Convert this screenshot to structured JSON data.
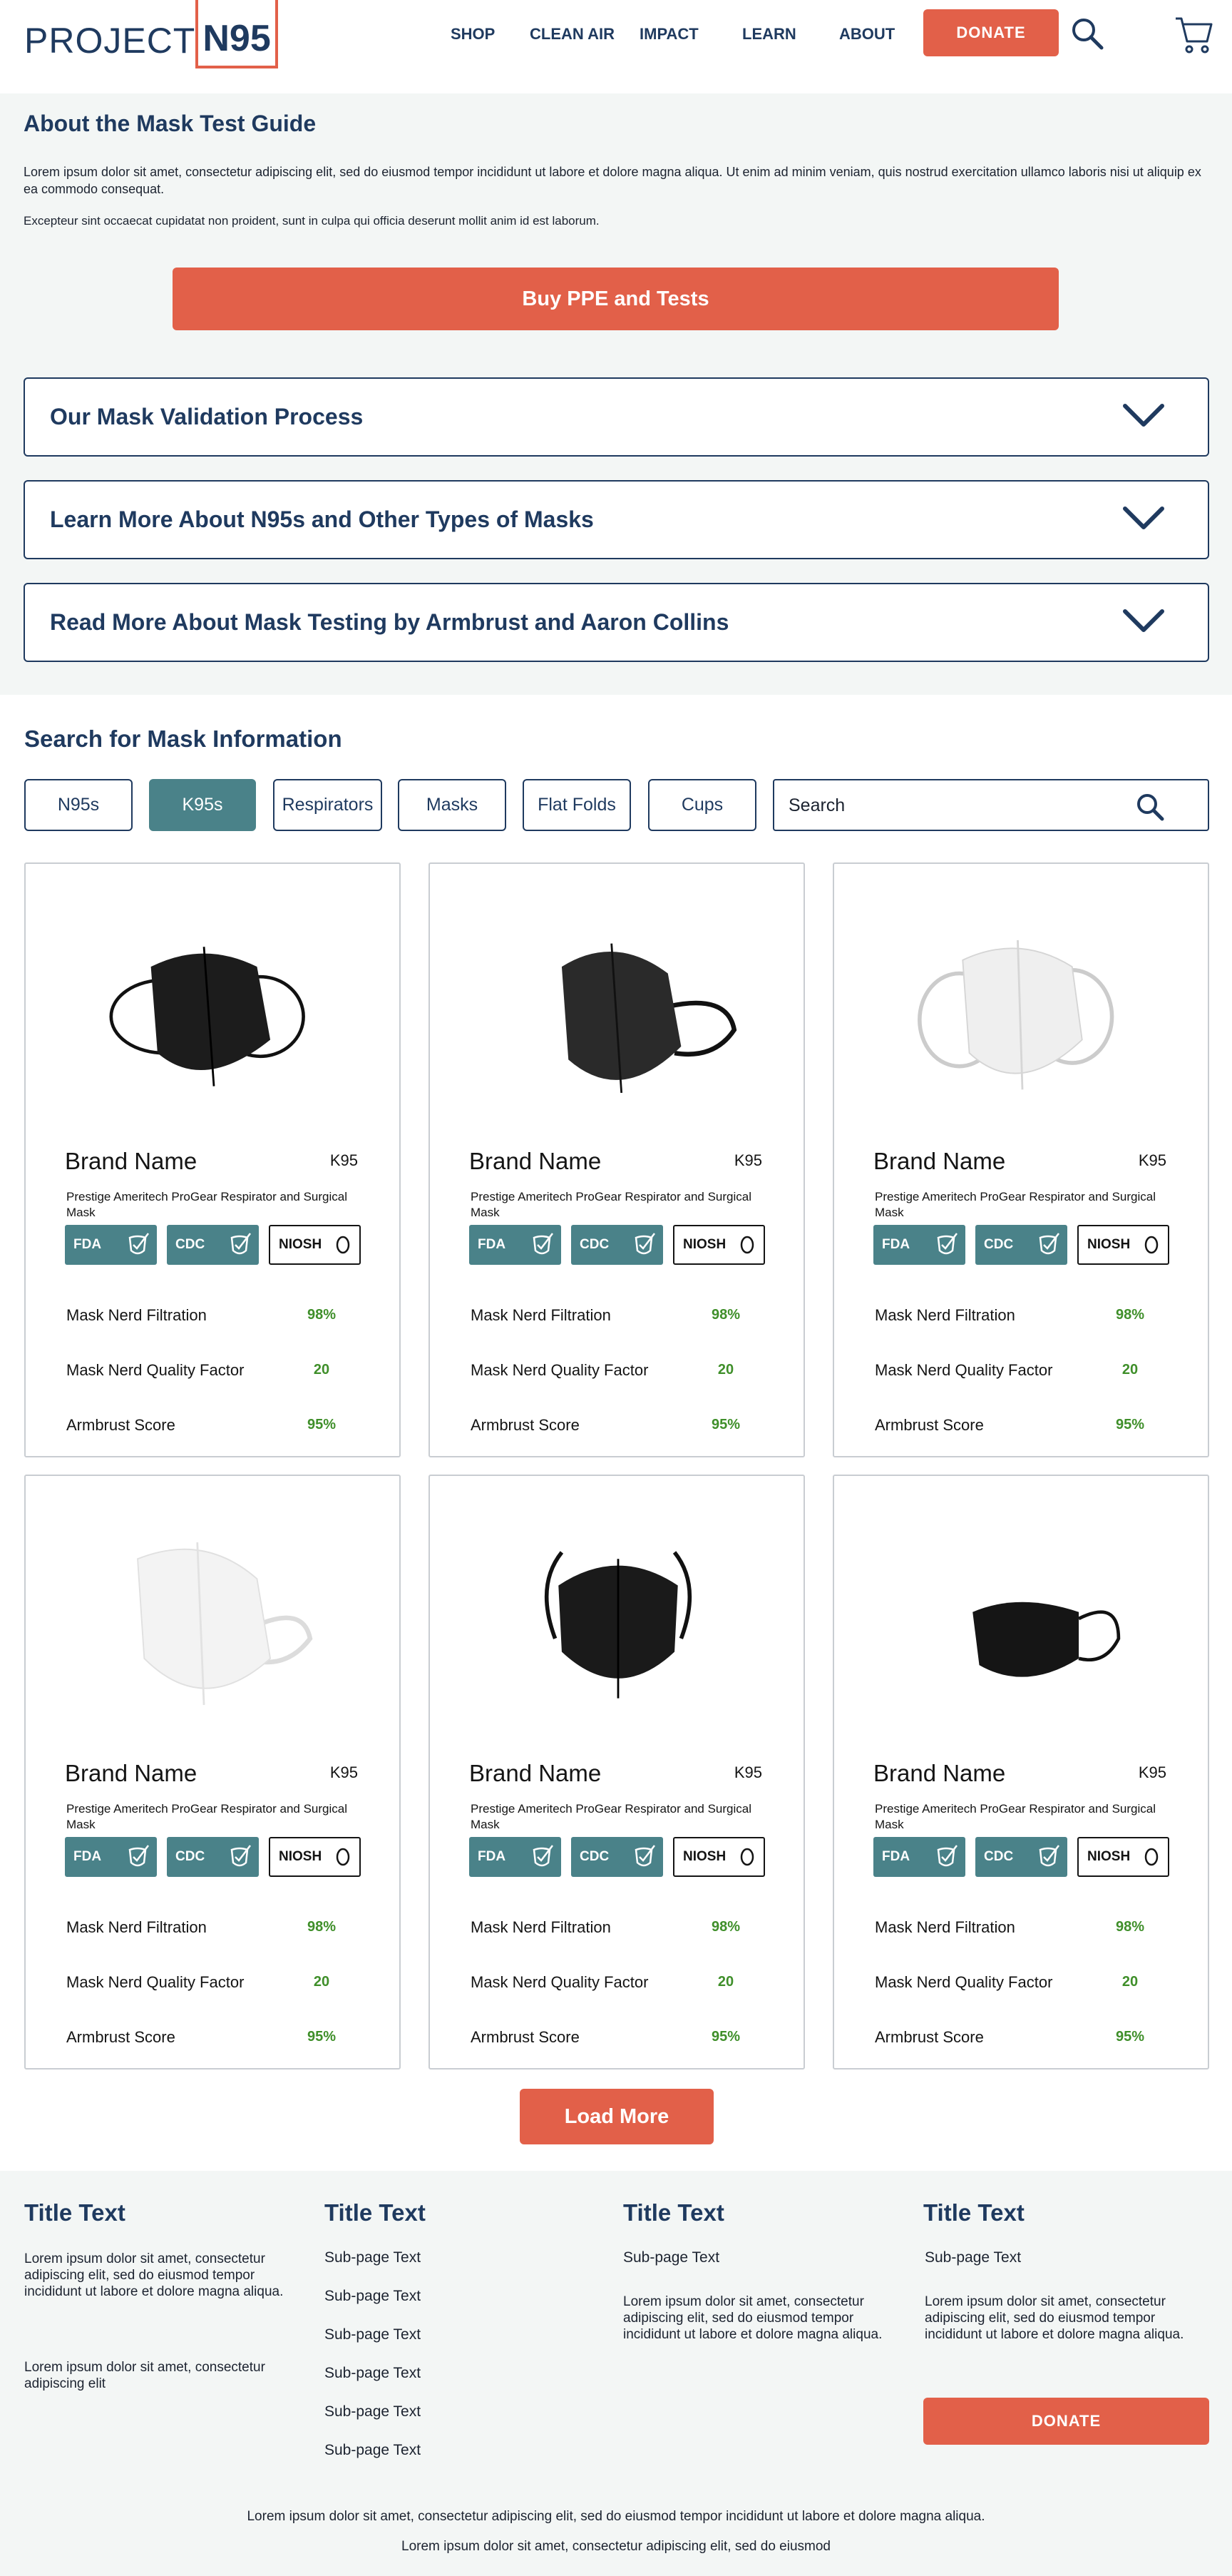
{
  "colors": {
    "primary": "#1f3a5f",
    "accent": "#e26049",
    "teal": "#4a8289",
    "score_green": "#3f8f2a",
    "section_bg": "#f3f6f5"
  },
  "header": {
    "logo_project": "PROJECT",
    "logo_n95": "N95",
    "nav": [
      "SHOP",
      "CLEAN AIR",
      "IMPACT",
      "LEARN",
      "ABOUT"
    ],
    "donate": "DONATE",
    "search_icon": "search-icon",
    "cart_icon": "cart-icon"
  },
  "about": {
    "title": "About the Mask Test Guide",
    "paragraph1": "Lorem ipsum dolor sit amet, consectetur adipiscing elit, sed do eiusmod tempor incididunt ut labore et dolore magna aliqua. Ut enim ad minim veniam, quis nostrud exercitation ullamco laboris nisi ut aliquip ex ea commodo consequat.",
    "paragraph2": "Excepteur sint occaecat cupidatat non proident, sunt in culpa qui officia deserunt mollit anim id est laborum.",
    "buy_button": "Buy PPE and Tests",
    "accordions": [
      "Our Mask Validation Process",
      "Learn More About N95s and Other Types of Masks",
      "Read More About Mask Testing by Armbrust and Aaron Collins"
    ]
  },
  "search": {
    "title": "Search for Mask Information",
    "filters": [
      "N95s",
      "K95s",
      "Respirators",
      "Masks",
      "Flat Folds",
      "Cups"
    ],
    "active_filter": "K95s",
    "placeholder": "Search"
  },
  "cards": [
    {
      "brand": "Brand Name",
      "type": "K95",
      "description": "Prestige Ameritech ProGear Respirator and Surgical Mask",
      "badges": [
        "FDA",
        "CDC",
        "NIOSH"
      ],
      "metrics": [
        {
          "label": "Mask Nerd Filtration",
          "value": "98%"
        },
        {
          "label": "Mask Nerd Quality Factor",
          "value": "20"
        },
        {
          "label": "Armbrust Score",
          "value": "95%"
        }
      ]
    },
    {
      "brand": "Brand Name",
      "type": "K95",
      "description": "Prestige Ameritech ProGear Respirator and Surgical Mask",
      "badges": [
        "FDA",
        "CDC",
        "NIOSH"
      ],
      "metrics": [
        {
          "label": "Mask Nerd Filtration",
          "value": "98%"
        },
        {
          "label": "Mask Nerd Quality Factor",
          "value": "20"
        },
        {
          "label": "Armbrust Score",
          "value": "95%"
        }
      ]
    },
    {
      "brand": "Brand Name",
      "type": "K95",
      "description": "Prestige Ameritech ProGear Respirator and Surgical Mask",
      "badges": [
        "FDA",
        "CDC",
        "NIOSH"
      ],
      "metrics": [
        {
          "label": "Mask Nerd Filtration",
          "value": "98%"
        },
        {
          "label": "Mask Nerd Quality Factor",
          "value": "20"
        },
        {
          "label": "Armbrust Score",
          "value": "95%"
        }
      ]
    },
    {
      "brand": "Brand Name",
      "type": "K95",
      "description": "Prestige Ameritech ProGear Respirator and Surgical Mask",
      "badges": [
        "FDA",
        "CDC",
        "NIOSH"
      ],
      "metrics": [
        {
          "label": "Mask Nerd Filtration",
          "value": "98%"
        },
        {
          "label": "Mask Nerd Quality Factor",
          "value": "20"
        },
        {
          "label": "Armbrust Score",
          "value": "95%"
        }
      ]
    },
    {
      "brand": "Brand Name",
      "type": "K95",
      "description": "Prestige Ameritech ProGear Respirator and Surgical Mask",
      "badges": [
        "FDA",
        "CDC",
        "NIOSH"
      ],
      "metrics": [
        {
          "label": "Mask Nerd Filtration",
          "value": "98%"
        },
        {
          "label": "Mask Nerd Quality Factor",
          "value": "20"
        },
        {
          "label": "Armbrust Score",
          "value": "95%"
        }
      ]
    },
    {
      "brand": "Brand Name",
      "type": "K95",
      "description": "Prestige Ameritech ProGear Respirator and Surgical Mask",
      "badges": [
        "FDA",
        "CDC",
        "NIOSH"
      ],
      "metrics": [
        {
          "label": "Mask Nerd Filtration",
          "value": "98%"
        },
        {
          "label": "Mask Nerd Quality Factor",
          "value": "20"
        },
        {
          "label": "Armbrust Score",
          "value": "95%"
        }
      ]
    }
  ],
  "load_more": "Load More",
  "footer": {
    "col1": {
      "title": "Title Text",
      "text1": "Lorem ipsum dolor sit amet, consectetur adipiscing elit, sed do eiusmod tempor incididunt ut labore et dolore magna aliqua.",
      "text2": "Lorem ipsum dolor sit amet, consectetur adipiscing elit"
    },
    "col2": {
      "title": "Title Text",
      "links": [
        "Sub-page Text",
        "Sub-page Text",
        "Sub-page Text",
        "Sub-page Text",
        "Sub-page Text",
        "Sub-page Text"
      ]
    },
    "col3": {
      "title": "Title Text",
      "subtitle": "Sub-page Text",
      "text": "Lorem ipsum dolor sit amet, consectetur adipiscing elit, sed do eiusmod tempor incididunt ut labore et dolore magna aliqua."
    },
    "col4": {
      "title": "Title Text",
      "subtitle": "Sub-page Text",
      "text": "Lorem ipsum dolor sit amet, consectetur adipiscing elit, sed do eiusmod tempor incididunt ut labore et dolore magna aliqua.",
      "donate": "DONATE"
    },
    "bottom1": "Lorem ipsum dolor sit amet, consectetur adipiscing elit, sed do eiusmod tempor incididunt ut labore et dolore magna aliqua.",
    "bottom2": "Lorem ipsum dolor sit amet, consectetur adipiscing elit, sed do eiusmod"
  }
}
